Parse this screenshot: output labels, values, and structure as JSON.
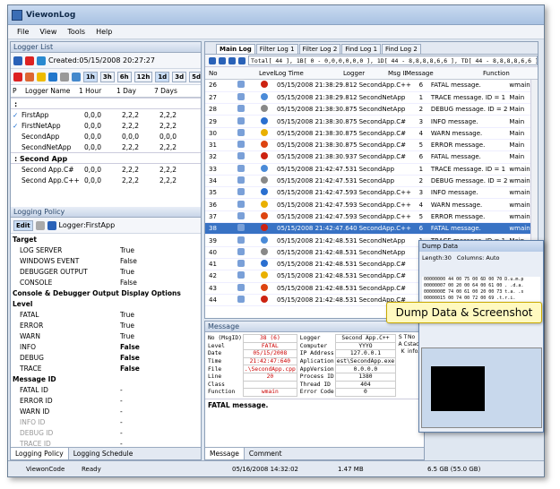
{
  "app": {
    "title": "ViewonLog"
  },
  "menu": [
    "File",
    "View",
    "Tools",
    "Help"
  ],
  "logger_list": {
    "title": "Logger List",
    "created": "Created:05/15/2008 20:27:27",
    "buttons": [
      "1h",
      "3h",
      "6h",
      "12h",
      "1d",
      "3d",
      "5d",
      "7d"
    ],
    "columns": [
      "Logger Name",
      "1 Hour",
      "1 Day",
      "7 Days"
    ],
    "groups": [
      {
        "name": ":",
        "rows": [
          {
            "name": "FirstApp",
            "check": "✓",
            "h": "0,0,0",
            "d": "2,2,2",
            "w": "2,2,2"
          },
          {
            "name": "FirstNetApp",
            "check": "✓",
            "h": "0,0,0",
            "d": "2,2,2",
            "w": "2,2,2"
          },
          {
            "name": "SecondApp",
            "check": "",
            "h": "0,0,0",
            "d": "0,0,0",
            "w": "0,0,0"
          },
          {
            "name": "SecondNetApp",
            "check": "",
            "h": "0,0,0",
            "d": "2,2,2",
            "w": "2,2,2"
          }
        ]
      },
      {
        "name": ": Second App",
        "rows": [
          {
            "name": "Second App.C#",
            "check": "",
            "h": "0,0,0",
            "d": "2,2,2",
            "w": "2,2,2"
          },
          {
            "name": "Second App.C++",
            "check": "",
            "h": "0,0,0",
            "d": "2,2,2",
            "w": "2,2,2"
          }
        ]
      }
    ]
  },
  "logging_policy": {
    "title": "Logging Policy",
    "edit": "Edit",
    "logger": "Logger:FirstApp",
    "sections": [
      {
        "name": "Target",
        "rows": [
          [
            "LOG SERVER",
            "True"
          ],
          [
            "WINDOWS EVENT",
            "False"
          ],
          [
            "DEBUGGER OUTPUT",
            "True"
          ],
          [
            "CONSOLE",
            "False"
          ]
        ]
      },
      {
        "name": "Console & Debugger Output Display Options",
        "rows": []
      },
      {
        "name": "Level",
        "rows": [
          [
            "FATAL",
            "True"
          ],
          [
            "ERROR",
            "True"
          ],
          [
            "WARN",
            "True"
          ],
          [
            "INFO",
            "False"
          ],
          [
            "DEBUG",
            "False"
          ],
          [
            "TRACE",
            "False"
          ]
        ]
      },
      {
        "name": "Message ID",
        "rows": [
          [
            "FATAL ID",
            "-"
          ],
          [
            "ERROR ID",
            "-"
          ],
          [
            "WARN ID",
            "-"
          ],
          [
            "INFO ID",
            "-"
          ],
          [
            "DEBUG ID",
            "-"
          ],
          [
            "TRACE ID",
            "-"
          ]
        ]
      }
    ],
    "tabs": [
      "Logging Policy",
      "Logging Schedule"
    ]
  },
  "main_log": {
    "tabs": [
      "Main Log",
      "Filter Log 1",
      "Filter Log 2",
      "Find Log 1",
      "Find Log 2"
    ],
    "filter": "Total[ 44 ], 1B[ 0 - 0,0,0,0,0,0 ], 1D[ 44 - 8,8,8,8,6,6 ], TD[ 44 - 8,8,8,8,6,6 ]",
    "columns": [
      "No",
      "Level",
      "Log Time",
      "Logger",
      "Msg ID",
      "Message",
      "Function"
    ],
    "rows": [
      [
        "26",
        "05/15/2008 21:38:29.812",
        "SecondApp.C++",
        "6",
        "FATAL message.",
        "wmain"
      ],
      [
        "27",
        "05/15/2008 21:38:29.812",
        "SecondNetApp",
        "1",
        "TRACE message. ID = 1",
        "Main"
      ],
      [
        "28",
        "05/15/2008 21:38:30.875",
        "SecondNetApp",
        "2",
        "DEBUG message. ID = 2",
        "Main"
      ],
      [
        "29",
        "05/15/2008 21:38:30.875",
        "SecondApp.C#",
        "3",
        "INFO message.",
        "Main"
      ],
      [
        "30",
        "05/15/2008 21:38:30.875",
        "SecondApp.C#",
        "4",
        "WARN message.",
        "Main"
      ],
      [
        "31",
        "05/15/2008 21:38:30.875",
        "SecondApp.C#",
        "5",
        "ERROR message.",
        "Main"
      ],
      [
        "32",
        "05/15/2008 21:38:30.937",
        "SecondApp.C#",
        "6",
        "FATAL message.",
        "Main"
      ],
      [
        "33",
        "05/15/2008 21:42:47.531",
        "SecondApp",
        "1",
        "TRACE message. ID = 1",
        "wmain"
      ],
      [
        "34",
        "05/15/2008 21:42:47.531",
        "SecondApp",
        "2",
        "DEBUG message. ID = 2",
        "wmain"
      ],
      [
        "35",
        "05/15/2008 21:42:47.593",
        "SecondApp.C++",
        "3",
        "INFO message.",
        "wmain"
      ],
      [
        "36",
        "05/15/2008 21:42:47.593",
        "SecondApp.C++",
        "4",
        "WARN message.",
        "wmain"
      ],
      [
        "37",
        "05/15/2008 21:42:47.593",
        "SecondApp.C++",
        "5",
        "ERROR message.",
        "wmain"
      ],
      [
        "38",
        "05/15/2008 21:42:47.640",
        "SecondApp.C++",
        "6",
        "FATAL message.",
        "wmain"
      ],
      [
        "39",
        "05/15/2008 21:42:48.531",
        "SecondNetApp",
        "1",
        "TRACE message. ID = 1",
        "Main"
      ],
      [
        "40",
        "05/15/2008 21:42:48.531",
        "SecondNetApp",
        "2",
        "DEBUG message. ID = 2",
        "Main"
      ],
      [
        "41",
        "05/15/2008 21:42:48.531",
        "SecondApp.C#",
        "3",
        "INFO message.",
        ""
      ],
      [
        "42",
        "05/15/2008 21:42:48.531",
        "SecondApp.C#",
        "4",
        "WARN",
        ""
      ],
      [
        "43",
        "05/15/2008 21:42:48.531",
        "SecondApp.C#",
        "5",
        "ERRO",
        ""
      ],
      [
        "44",
        "05/15/2008 21:42:48.531",
        "SecondApp.C#",
        "6",
        "FATA",
        ""
      ]
    ],
    "levels": [
      "fatal",
      "trace",
      "debug",
      "info",
      "warn",
      "error",
      "fatal",
      "trace",
      "debug",
      "info",
      "warn",
      "error",
      "fatal",
      "trace",
      "debug",
      "info",
      "warn",
      "error",
      "fatal"
    ],
    "selected_index": 12
  },
  "message": {
    "title": "Message",
    "left": [
      [
        "No (MsgID)",
        "38 (6)"
      ],
      [
        "Level",
        "FATAL"
      ],
      [
        "Date",
        "05/15/2008"
      ],
      [
        "Time",
        "21:42:47:640"
      ],
      [
        "File",
        ".\\SecondApp.cpp"
      ],
      [
        "Line",
        "20"
      ],
      [
        "Class",
        ""
      ],
      [
        "Function",
        "wmain"
      ]
    ],
    "right": [
      [
        "Logger",
        "Second App.C++"
      ],
      [
        "Computer",
        "YYYO"
      ],
      [
        "IP Address",
        "127.0.0.1"
      ],
      [
        "Aplication",
        "est\\SecondApp.exe"
      ],
      [
        "AppVersion",
        "0.0.0.0"
      ],
      [
        "Process ID",
        "1380"
      ],
      [
        "Thread ID",
        "404"
      ],
      [
        "Error Code",
        "0"
      ]
    ],
    "stack": "No stack info...",
    "text": "FATAL message.",
    "tabs": [
      "Message",
      "Comment"
    ]
  },
  "dump": {
    "title": "Dump Data",
    "length": "Length:30",
    "columns": "Columns: Auto",
    "hex": [
      "00000000 44 00 75 00 6D 00 70 D.u.m.p",
      "00000007 00 20 00 64 00 61 00 . .d.a.",
      "0000000E 74 00 61 00 20 00 73 t.a. .s",
      "00000015 00 74 00 72 00 69 .t.r.i."
    ]
  },
  "callout": "Dump Data & Screenshot",
  "status": {
    "app": "ViewonCode",
    "state": "Ready",
    "datetime": "05/16/2008 14:32:02",
    "mem": "1.47 MB",
    "disk": "6.5 GB (55.0 GB)"
  }
}
